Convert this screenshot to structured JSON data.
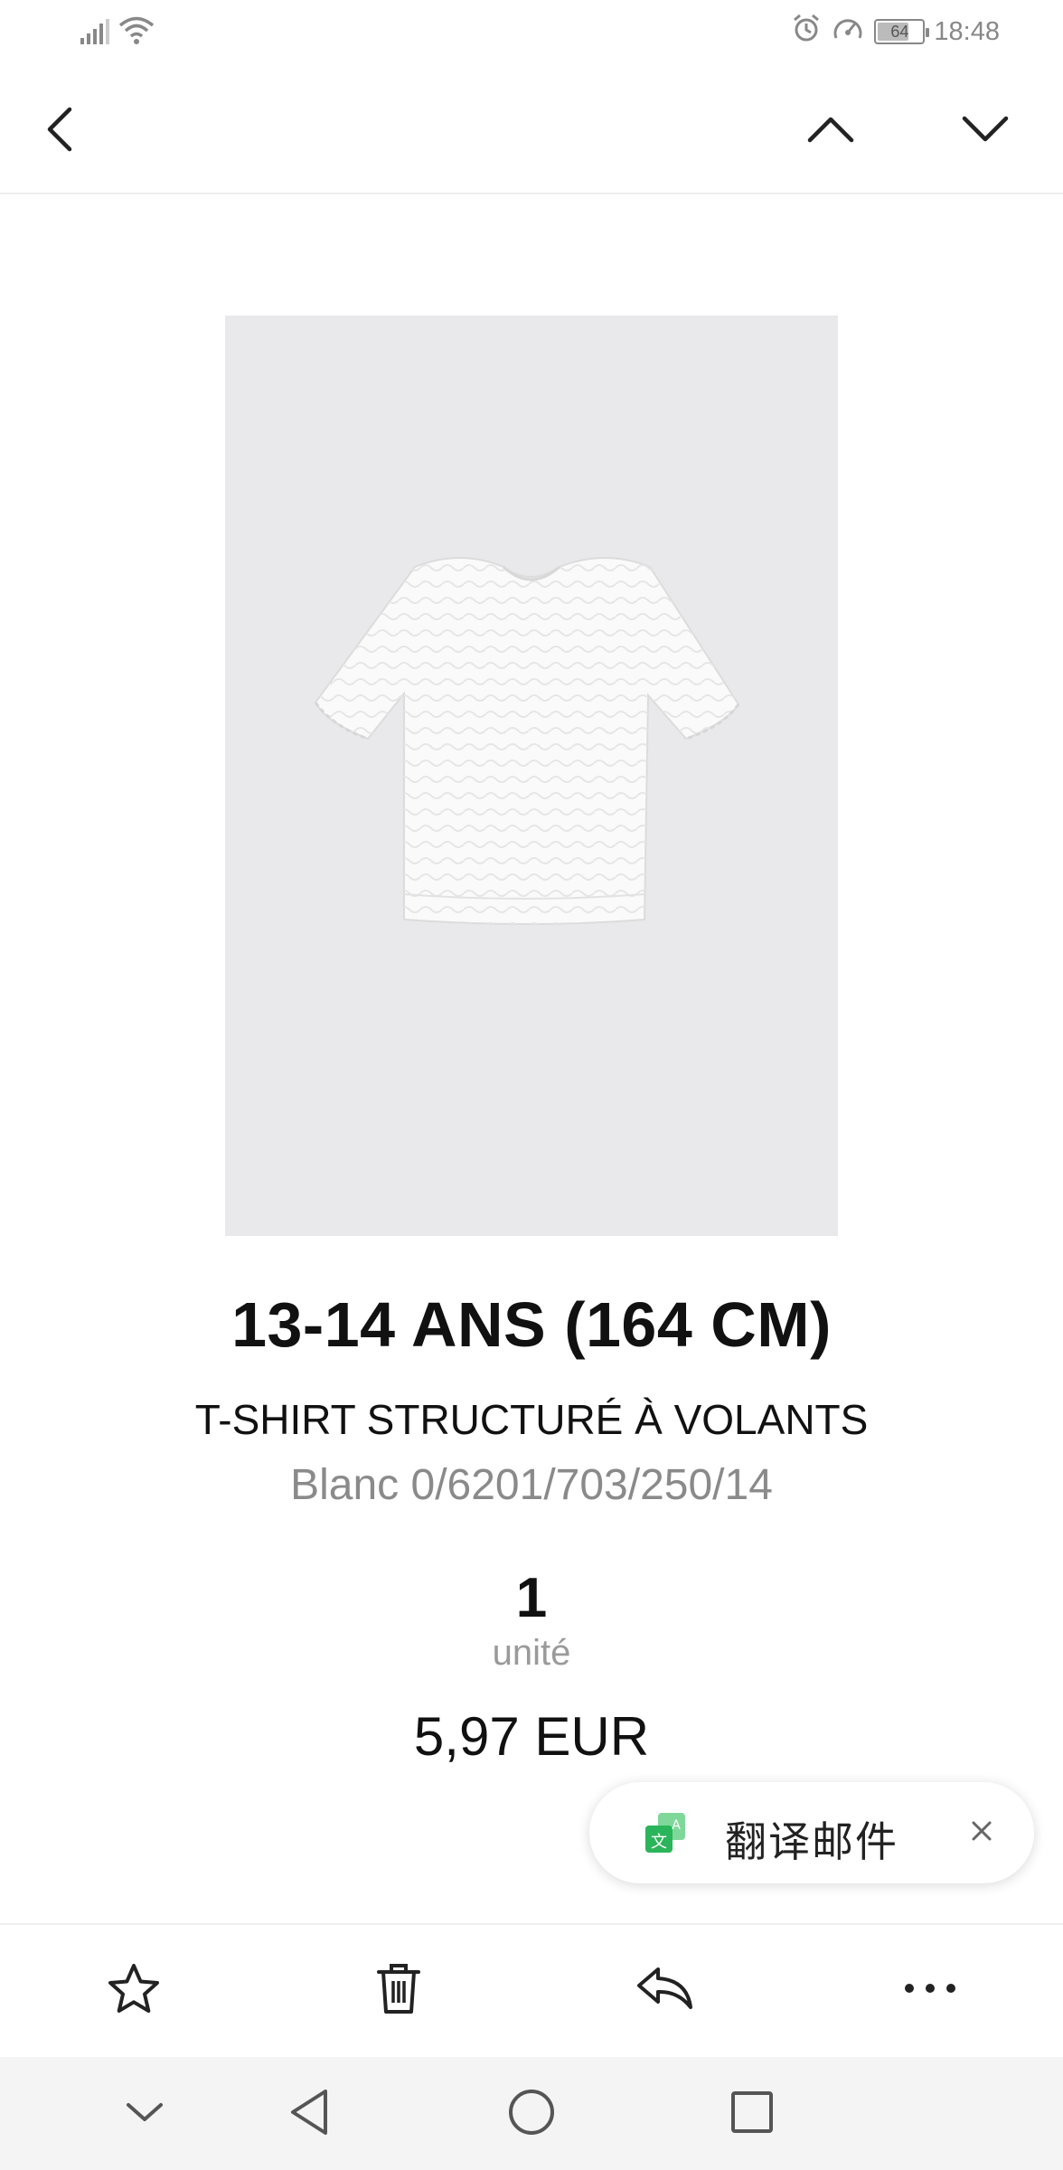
{
  "status_bar": {
    "battery_level": "64",
    "time": "18:48"
  },
  "product": {
    "size": "13-14 ANS (164 CM)",
    "name": "T-SHIRT STRUCTURÉ À VOLANTS",
    "reference": "Blanc 0/6201/703/250/14",
    "quantity": "1",
    "quantity_unit": "unité",
    "price": "5,97 EUR"
  },
  "translate_chip": {
    "label": "翻译邮件"
  },
  "icons": {
    "top_bar": [
      "back-arrow-icon",
      "chevron-up-icon",
      "chevron-down-icon"
    ],
    "action_bar": [
      "star-icon",
      "trash-icon",
      "reply-icon",
      "more-icon"
    ],
    "nav_bar": [
      "nav-collapse-icon",
      "nav-back-icon",
      "nav-home-icon",
      "nav-recents-icon"
    ]
  },
  "colors": {
    "background": "#ffffff",
    "image_background": "#e9e9eb",
    "secondary_text": "#8a8a8a",
    "translate_icon_green": "#2bb55a"
  }
}
